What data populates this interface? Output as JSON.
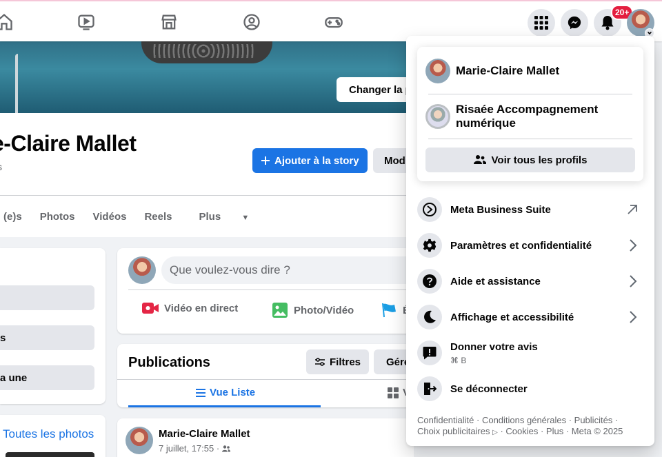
{
  "colors": {
    "accent": "#1b74e4",
    "badge": "#e41e3f",
    "secondary_text": "#65676b",
    "button_gray": "#e4e6eb"
  },
  "topbar": {
    "icons": [
      "home-icon",
      "watch-icon",
      "marketplace-icon",
      "groups-icon",
      "gaming-icon",
      "apps-grid-icon",
      "messenger-icon",
      "bell-icon"
    ],
    "notification_count": "20+"
  },
  "cover": {
    "edit_cover_label": "Changer la photo de couverture"
  },
  "profile": {
    "name": "Marie-Claire Mallet",
    "name_visible": "e-Claire Mallet",
    "subtitle": "s",
    "add_story_label": "Ajouter à la story",
    "edit_label": "Modifier le profil",
    "tabs": [
      "(e)s",
      "Photos",
      "Vidéos",
      "Reels",
      "Plus"
    ]
  },
  "left": {
    "pills": [
      "",
      "s",
      "a une"
    ],
    "all_photos": "Toutes les photos"
  },
  "composer": {
    "placeholder": "Que voulez-vous dire ?",
    "actions": [
      "Vidéo en direct",
      "Photo/Vidéo",
      "É"
    ]
  },
  "publications": {
    "title": "Publications",
    "filters_label": "Filtres",
    "manage_label": "Gérer",
    "view_list": "Vue Liste",
    "view_grid": "V"
  },
  "post": {
    "author": "Marie-Claire Mallet",
    "date": "7 juillet, 17:55 ·"
  },
  "menu": {
    "profiles": [
      {
        "name": "Marie-Claire Mallet"
      },
      {
        "name": "Risaée Accompagnement numérique"
      }
    ],
    "see_all_profiles": "Voir tous les profils",
    "items": [
      {
        "label": "Meta Business Suite",
        "icon": "meta-business-icon",
        "trail": "external-arrow-icon"
      },
      {
        "label": "Paramètres et confidentialité",
        "icon": "gear-icon",
        "trail": "chevron-right-icon"
      },
      {
        "label": "Aide et assistance",
        "icon": "help-icon",
        "trail": "chevron-right-icon"
      },
      {
        "label": "Affichage et accessibilité",
        "icon": "moon-icon",
        "trail": "chevron-right-icon"
      },
      {
        "label": "Donner votre avis",
        "sub": "⌘ B",
        "icon": "feedback-icon"
      },
      {
        "label": "Se déconnecter",
        "icon": "logout-icon"
      }
    ],
    "footer": [
      "Confidentialité",
      "Conditions générales",
      "Publicités",
      "Choix publicitaires",
      "Cookies",
      "Plus",
      "Meta © 2025"
    ]
  }
}
